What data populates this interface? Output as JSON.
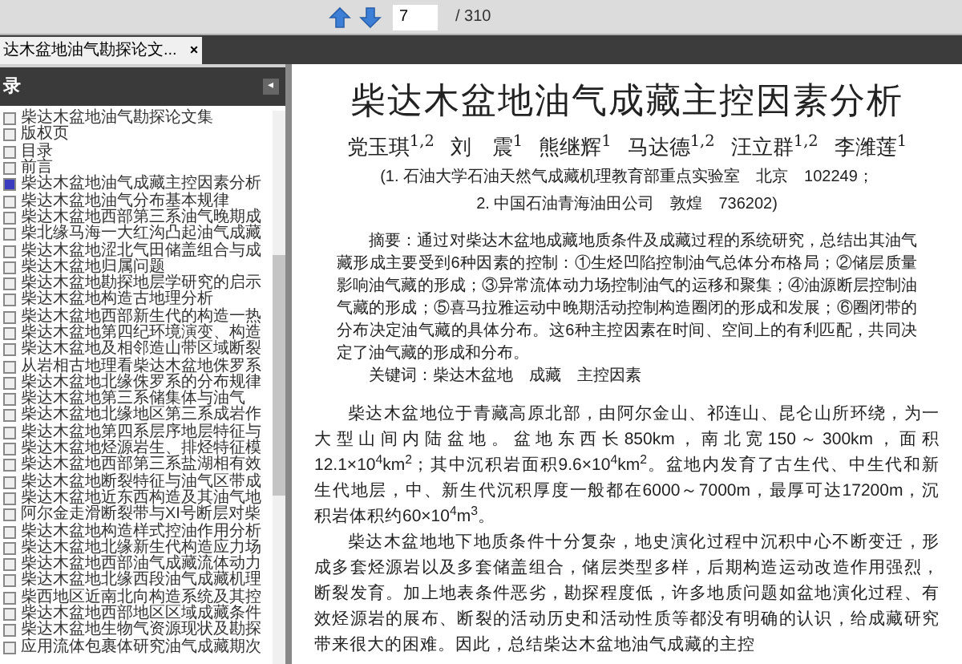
{
  "toolbar": {
    "page_field": {
      "value": "7"
    },
    "page_total": "/ 310"
  },
  "tabs": [
    {
      "label": "达木盆地油气勘探论文...",
      "close": "×",
      "selected": true
    }
  ],
  "sidebar": {
    "title": "录",
    "collapse": "◂",
    "items": [
      {
        "label": "柴达木盆地油气勘探论文集",
        "checked": false
      },
      {
        "label": "版权页",
        "checked": false
      },
      {
        "label": "目录",
        "checked": false
      },
      {
        "label": "前言",
        "checked": false
      },
      {
        "label": "柴达木盆地油气成藏主控因素分析",
        "checked": true
      },
      {
        "label": "柴达木盆地油气分布基本规律",
        "checked": false
      },
      {
        "label": "柴达木盆地西部第三系油气晚期成",
        "checked": false
      },
      {
        "label": "柴北缘马海一大红沟凸起油气成藏",
        "checked": false
      },
      {
        "label": "柴达木盆地涩北气田储盖组合与成",
        "checked": false
      },
      {
        "label": "柴达木盆地归属问题",
        "checked": false
      },
      {
        "label": "柴达木盆地勘探地层学研究的启示",
        "checked": false
      },
      {
        "label": "柴达木盆地构造古地理分析",
        "checked": false
      },
      {
        "label": "柴达木盆地西部新生代的构造一热",
        "checked": false
      },
      {
        "label": "柴达木盆地第四纪环境演变、构造",
        "checked": false
      },
      {
        "label": "柴达木盆地及相邻造山带区域断裂",
        "checked": false
      },
      {
        "label": "从岩相古地理看柴达木盆地侏罗系",
        "checked": false
      },
      {
        "label": "柴达木盆地北缘侏罗系的分布规律",
        "checked": false
      },
      {
        "label": "柴达木盆地第三系储集体与油气",
        "checked": false
      },
      {
        "label": "柴达木盆地北缘地区第三系成岩作",
        "checked": false
      },
      {
        "label": "柴达木盆地第四系层序地层特征与",
        "checked": false
      },
      {
        "label": "柴达木盆地烃源岩生、排烃特征模",
        "checked": false
      },
      {
        "label": "柴达木盆地西部第三系盐湖相有效",
        "checked": false
      },
      {
        "label": "柴达木盆地断裂特征与油气区带成",
        "checked": false
      },
      {
        "label": "柴达木盆地近东西构造及其油气地",
        "checked": false
      },
      {
        "label": "阿尔金走滑断裂带与XI号断层对柴",
        "checked": false
      },
      {
        "label": "柴达木盆地构造样式控油作用分析",
        "checked": false
      },
      {
        "label": "柴达木盆地北缘新生代构造应力场",
        "checked": false
      },
      {
        "label": "柴达木盆地西部油气成藏流体动力",
        "checked": false
      },
      {
        "label": "柴达木盆地北缘西段油气成藏机理",
        "checked": false
      },
      {
        "label": "柴西地区近南北向构造系统及其控",
        "checked": false
      },
      {
        "label": "柴达木盆地西部地区区域成藏条件",
        "checked": false
      },
      {
        "label": "柴达木盆地生物气资源现状及勘探",
        "checked": false
      },
      {
        "label": "应用流体包裹体研究油气成藏期次",
        "checked": false
      }
    ]
  },
  "document": {
    "title": "柴达木盆地油气成藏主控因素分析",
    "authors": [
      "党玉琪$^{1,2}$",
      "刘　震$^{1}$",
      "熊继辉$^{1}$",
      "马达德$^{1,2}$",
      "汪立群$^{1,2}$",
      "李潍莲$^{1}$"
    ],
    "affiliations": [
      "(1. 石油大学石油天然气成藏机理教育部重点实验室　北京　102249；",
      "2. 中国石油青海油田公司　敦煌　736202)"
    ],
    "abstract": "摘要：通过对柴达木盆地成藏地质条件及成藏过程的系统研究，总结出其油气藏形成主要受到6种因素的控制：①生烃凹陷控制油气总体分布格局；②储层质量影响油气藏的形成；③异常流体动力场控制油气的运移和聚集；④油源断层控制油气藏的形成；⑤喜马拉雅运动中晚期活动控制构造圈闭的形成和发展；⑥圈闭带的分布决定油气藏的具体分布。这6种主控因素在时间、空间上的有利匹配，共同决定了油气藏的形成和分布。",
    "keywords": "关键词：柴达木盆地　成藏　主控因素",
    "paragraphs": [
      "柴达木盆地位于青藏高原北部，由阿尔金山、祁连山、昆仑山所环绕，为一大型山间内陆盆地。盆地东西长850km，南北宽150～300km，面积12.1×10$^{4}$km$^{2}$；其中沉积岩面积9.6×10$^{4}$km$^{2}$。盆地内发育了古生代、中生代和新生代地层，中、新生代沉积厚度一般都在6000～7000m，最厚可达17200m，沉积岩体积约60×10$^{4}$m$^{3}$。",
      "柴达木盆地地下地质条件十分复杂，地史演化过程中沉积中心不断变迁，形成多套烃源岩以及多套储盖组合，储层类型多样，后期构造运动改造作用强烈，断裂发育。加上地表条件恶劣，勘探程度低，许多地质问题如盆地演化过程、有效烃源岩的展布、断裂的活动历史和活动性质等都没有明确的认识，给成藏研究带来很大的困难。因此，总结柴达木盆地油气成藏的主控"
    ]
  }
}
